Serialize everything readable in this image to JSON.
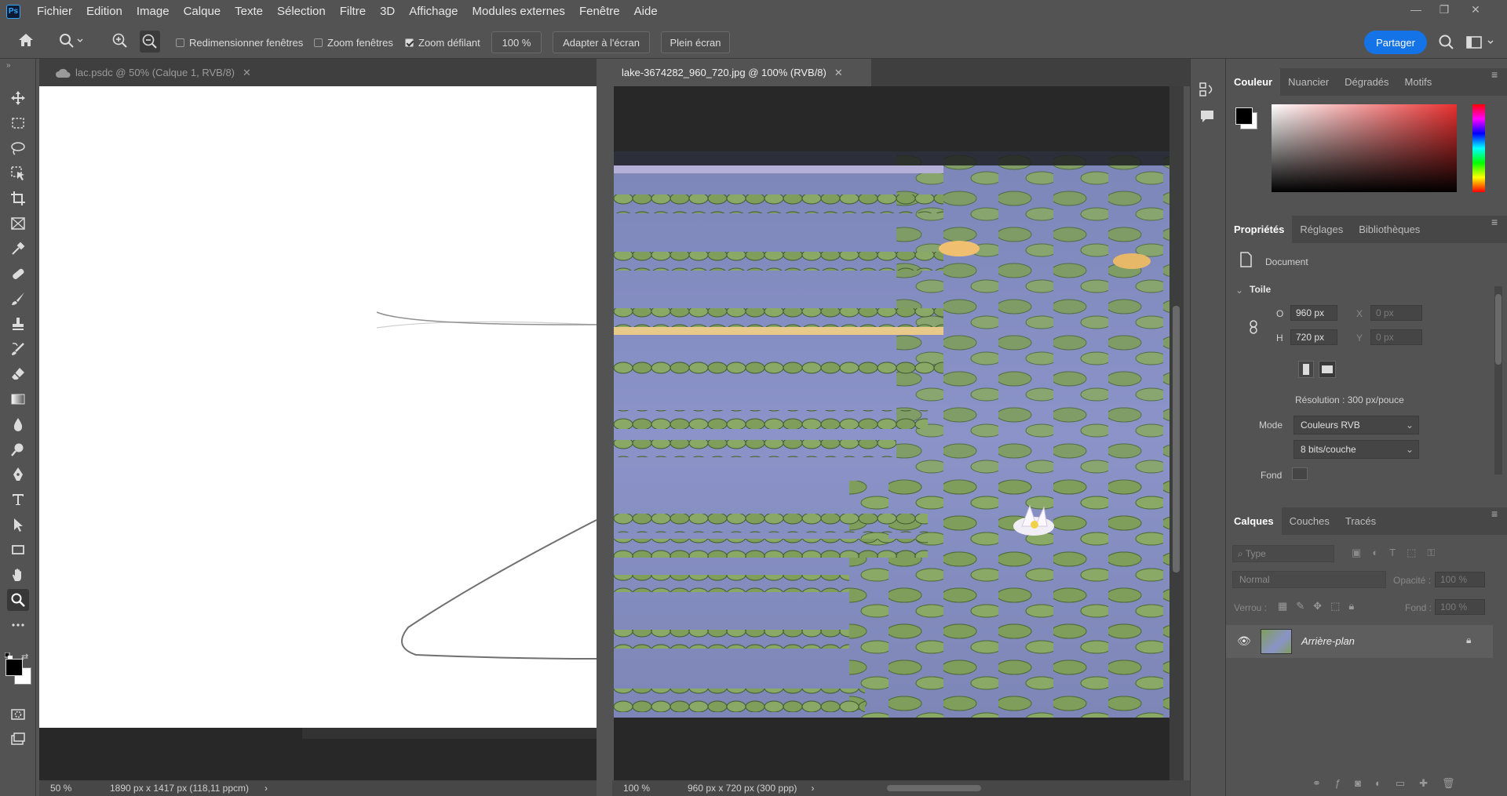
{
  "app": {
    "logo": "Ps"
  },
  "menu": [
    "Fichier",
    "Edition",
    "Image",
    "Calque",
    "Texte",
    "Sélection",
    "Filtre",
    "3D",
    "Affichage",
    "Modules externes",
    "Fenêtre",
    "Aide"
  ],
  "options": {
    "resize_windows": "Redimensionner fenêtres",
    "zoom_windows": "Zoom fenêtres",
    "scrubby_zoom": "Zoom défilant",
    "zoom_value": "100 %",
    "fit_screen": "Adapter à l'écran",
    "full_screen": "Plein écran",
    "share": "Partager"
  },
  "doc_left": {
    "tab_title": "lac.psdc @ 50% (Calque 1, RVB/8)",
    "zoom": "50 %",
    "size_info": "1890 px x 1417 px (118,11 ppcm)",
    "arrow": "›"
  },
  "doc_right": {
    "tab_title": "lake-3674282_960_720.jpg @ 100% (RVB/8)",
    "zoom": "100 %",
    "size_info": "960 px x 720 px (300 ppp)",
    "arrow": "›"
  },
  "color_panel": {
    "tabs": [
      "Couleur",
      "Nuancier",
      "Dégradés",
      "Motifs"
    ],
    "foreground": "#000000",
    "background": "#ffffff",
    "hue_color": "#e83030"
  },
  "properties_panel": {
    "tabs": [
      "Propriétés",
      "Réglages",
      "Bibliothèques"
    ],
    "doc_label": "Document",
    "section": "Toile",
    "w_label": "O",
    "w_value": "960 px",
    "h_label": "H",
    "h_value": "720 px",
    "x_label": "X",
    "x_value": "0 px",
    "y_label": "Y",
    "y_value": "0 px",
    "resolution": "Résolution : 300 px/pouce",
    "mode_label": "Mode",
    "mode_value": "Couleurs RVB",
    "depth_value": "8 bits/couche",
    "fond_label": "Fond"
  },
  "layers_panel": {
    "tabs": [
      "Calques",
      "Couches",
      "Tracés"
    ],
    "filter_placeholder": "Type",
    "blend_mode": "Normal",
    "opacity_label": "Opacité :",
    "opacity_value": "100 %",
    "lock_label": "Verrou :",
    "fill_label": "Fond :",
    "fill_value": "100 %",
    "layer_name": "Arrière-plan"
  }
}
